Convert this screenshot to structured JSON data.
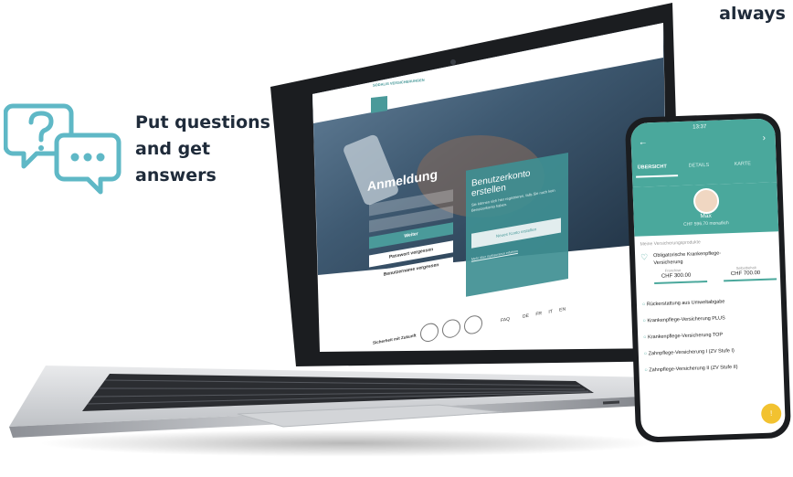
{
  "tagline": "always",
  "marketing": {
    "lines": [
      "Put questions",
      "and get",
      "answers"
    ],
    "icon": "question-chat-icon",
    "accent": "#5fb8c6"
  },
  "laptop_site": {
    "brand_name": "SODALIS VERSICHERUNGEN",
    "login": {
      "title": "Anmeldung",
      "submit": "Weiter",
      "forgot_password": "Passwort vergessen",
      "forgot_username": "Benutzername vergessen"
    },
    "register": {
      "title_line1": "Benutzerkonto",
      "title_line2": "erstellen",
      "body": "Sie können sich hier registrieren, falls Sie noch kein Benutzerkonto haben.",
      "button": "Neues Konto erstellen",
      "link": "Mehr über myInsurance erfahren"
    },
    "footer": {
      "slogan": "Sicherheit mit Zukunft",
      "faq": "FAQ",
      "languages": [
        "DE",
        "FR",
        "IT",
        "EN"
      ]
    },
    "colors": {
      "teal": "#4a9a9a",
      "teal_panel": "#3f8f92"
    }
  },
  "phone_app": {
    "status_time": "13:37",
    "tabs": [
      "ÜBERSICHT",
      "DETAILS",
      "KARTE"
    ],
    "user": {
      "name": "Max",
      "premium": "CHF 596.70 monatlich"
    },
    "section_title": "Meine Versicherungsprodukte",
    "main_product": {
      "title_line1": "Obligatorische Krankenpflege-",
      "title_line2": "Versicherung",
      "franchise_label": "Franchise",
      "franchise_value": "CHF 300.00",
      "selbstbehalt_label": "Selbstbehalt",
      "selbstbehalt_value": "CHF 700.00"
    },
    "products": [
      "Rückerstattung aus Umweltabgabe",
      "Krankenpflege-Versicherung PLUS",
      "Krankenpflege-Versicherung TOP",
      "Zahnpflege-Versicherung I (ZV Stufe I)",
      "Zahnpflege-Versicherung II (ZV Stufe II)"
    ],
    "fab_label": "!",
    "colors": {
      "header": "#4aa89c",
      "fab": "#f2c230"
    }
  }
}
